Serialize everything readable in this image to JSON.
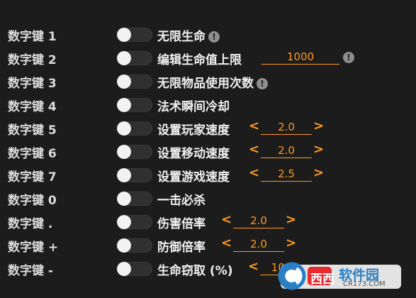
{
  "rows": [
    {
      "key": "数字键 1",
      "label": "无限生命",
      "info": "!"
    },
    {
      "key": "数字键 2",
      "label": "编辑生命值上限",
      "value": "1000",
      "info": "!"
    },
    {
      "key": "数字键 3",
      "label": "无限物品使用次数",
      "info": "!"
    },
    {
      "key": "数字键 4",
      "label": "法术瞬间冷却"
    },
    {
      "key": "数字键 5",
      "label": "设置玩家速度",
      "value": "2.0",
      "left_arrow": "<",
      "right_arrow": ">"
    },
    {
      "key": "数字键 6",
      "label": "设置移动速度",
      "value": "2.0",
      "left_arrow": "<",
      "right_arrow": ">"
    },
    {
      "key": "数字键 7",
      "label": "设置游戏速度",
      "value": "2.5",
      "left_arrow": "<",
      "right_arrow": ">"
    },
    {
      "key": "数字键 0",
      "label": "一击必杀"
    },
    {
      "key": "数字键 .",
      "label": "伤害倍率",
      "value": "2.0",
      "left_arrow": "<",
      "right_arrow": ">"
    },
    {
      "key": "数字键 +",
      "label": "防御倍率",
      "value": "2.0",
      "left_arrow": "<",
      "right_arrow": ">"
    },
    {
      "key": "数字键 -",
      "label": "生命窃取 (%)",
      "value": "100",
      "left_arrow": "<"
    }
  ],
  "watermark": {
    "brand": "西西",
    "text": "软件园",
    "url": "CR173.COM"
  },
  "colors": {
    "accent": "#ff9a1f",
    "background": "#1c1c1c",
    "toggle_knob": "#f2f2f2"
  }
}
